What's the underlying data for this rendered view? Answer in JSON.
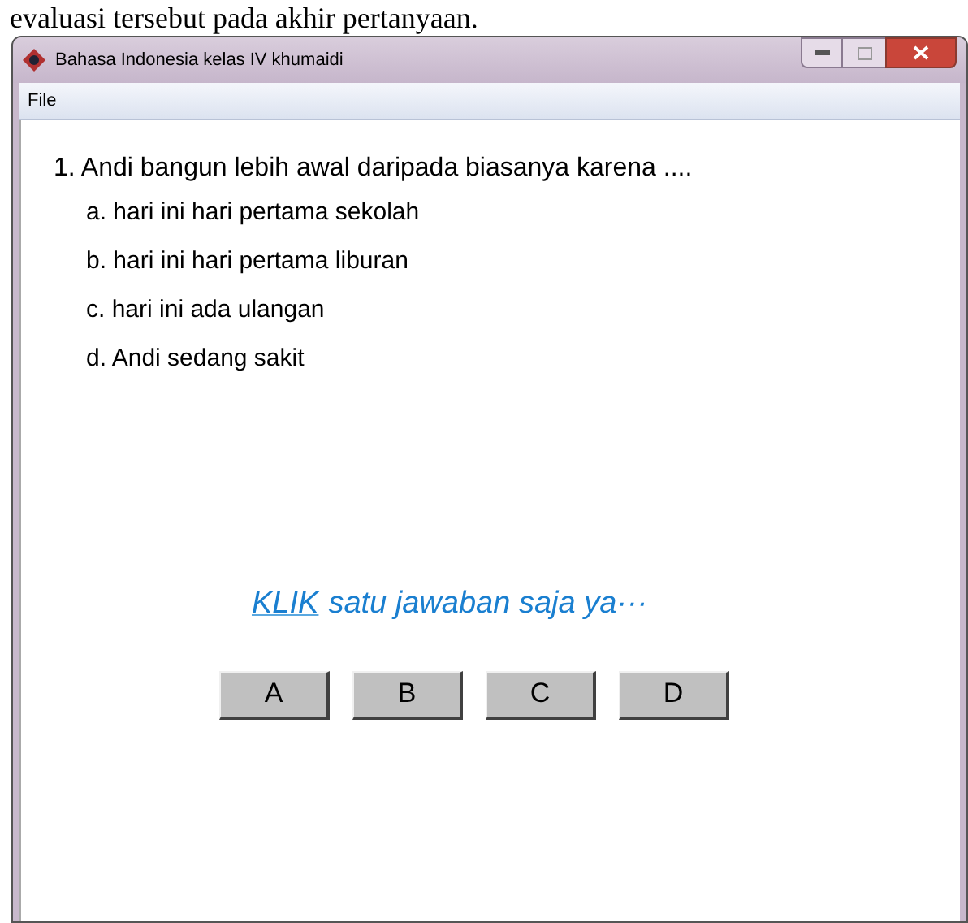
{
  "document_text": "evaluasi tersebut pada akhir pertanyaan.",
  "window": {
    "title": "Bahasa Indonesia kelas IV khumaidi"
  },
  "menu": [
    "File"
  ],
  "question": {
    "text": "1. Andi bangun lebih awal daripada biasanya karena ....",
    "options": [
      "a. hari ini hari pertama sekolah",
      "b. hari ini hari pertama liburan",
      "c. hari ini ada ulangan",
      "d. Andi sedang sakit"
    ]
  },
  "instruction": {
    "link": "KLIK",
    "text": "satu jawaban saja ya···"
  },
  "buttons": [
    "A",
    "B",
    "C",
    "D"
  ]
}
